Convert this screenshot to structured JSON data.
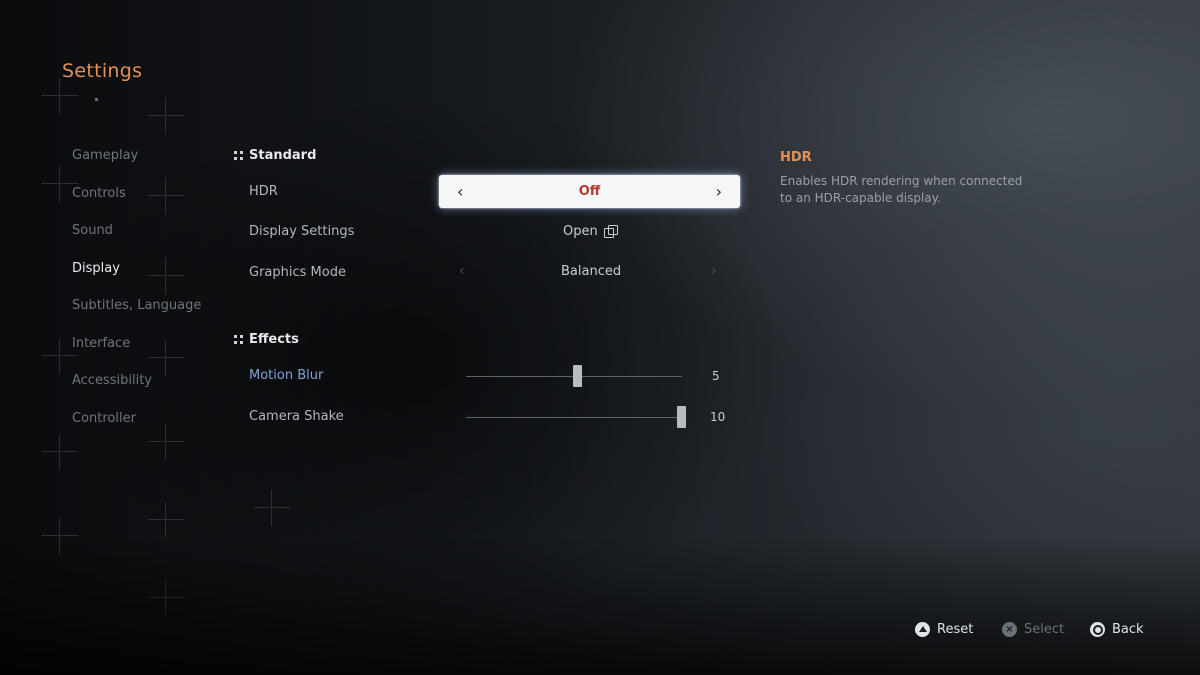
{
  "title": "Settings",
  "nav": [
    {
      "label": "Gameplay",
      "active": false
    },
    {
      "label": "Controls",
      "active": false
    },
    {
      "label": "Sound",
      "active": false
    },
    {
      "label": "Display",
      "active": true
    },
    {
      "label": "Subtitles, Language",
      "active": false
    },
    {
      "label": "Interface",
      "active": false
    },
    {
      "label": "Accessibility",
      "active": false
    },
    {
      "label": "Controller",
      "active": false
    }
  ],
  "sections": {
    "standard": "Standard",
    "effects": "Effects"
  },
  "rows": {
    "hdr": {
      "label": "HDR",
      "value": "Off"
    },
    "display_settings": {
      "label": "Display Settings",
      "value": "Open"
    },
    "graphics_mode": {
      "label": "Graphics Mode",
      "value": "Balanced"
    },
    "motion_blur": {
      "label": "Motion Blur",
      "value": "5",
      "level": 5,
      "max": 10
    },
    "camera_shake": {
      "label": "Camera Shake",
      "value": "10",
      "level": 10,
      "max": 10
    }
  },
  "description": {
    "title": "HDR",
    "text": "Enables HDR rendering when connected to an HDR-capable display."
  },
  "footer": {
    "reset": "Reset",
    "select": "Select",
    "back": "Back"
  },
  "colors": {
    "accent": "#e0925a",
    "selected_value": "#b53a2c",
    "highlight_label": "#7ea3d6"
  },
  "icons": {
    "reset": "triangle-button-icon",
    "select": "cross-button-icon",
    "back": "circle-button-icon",
    "open": "external-window-icon"
  }
}
